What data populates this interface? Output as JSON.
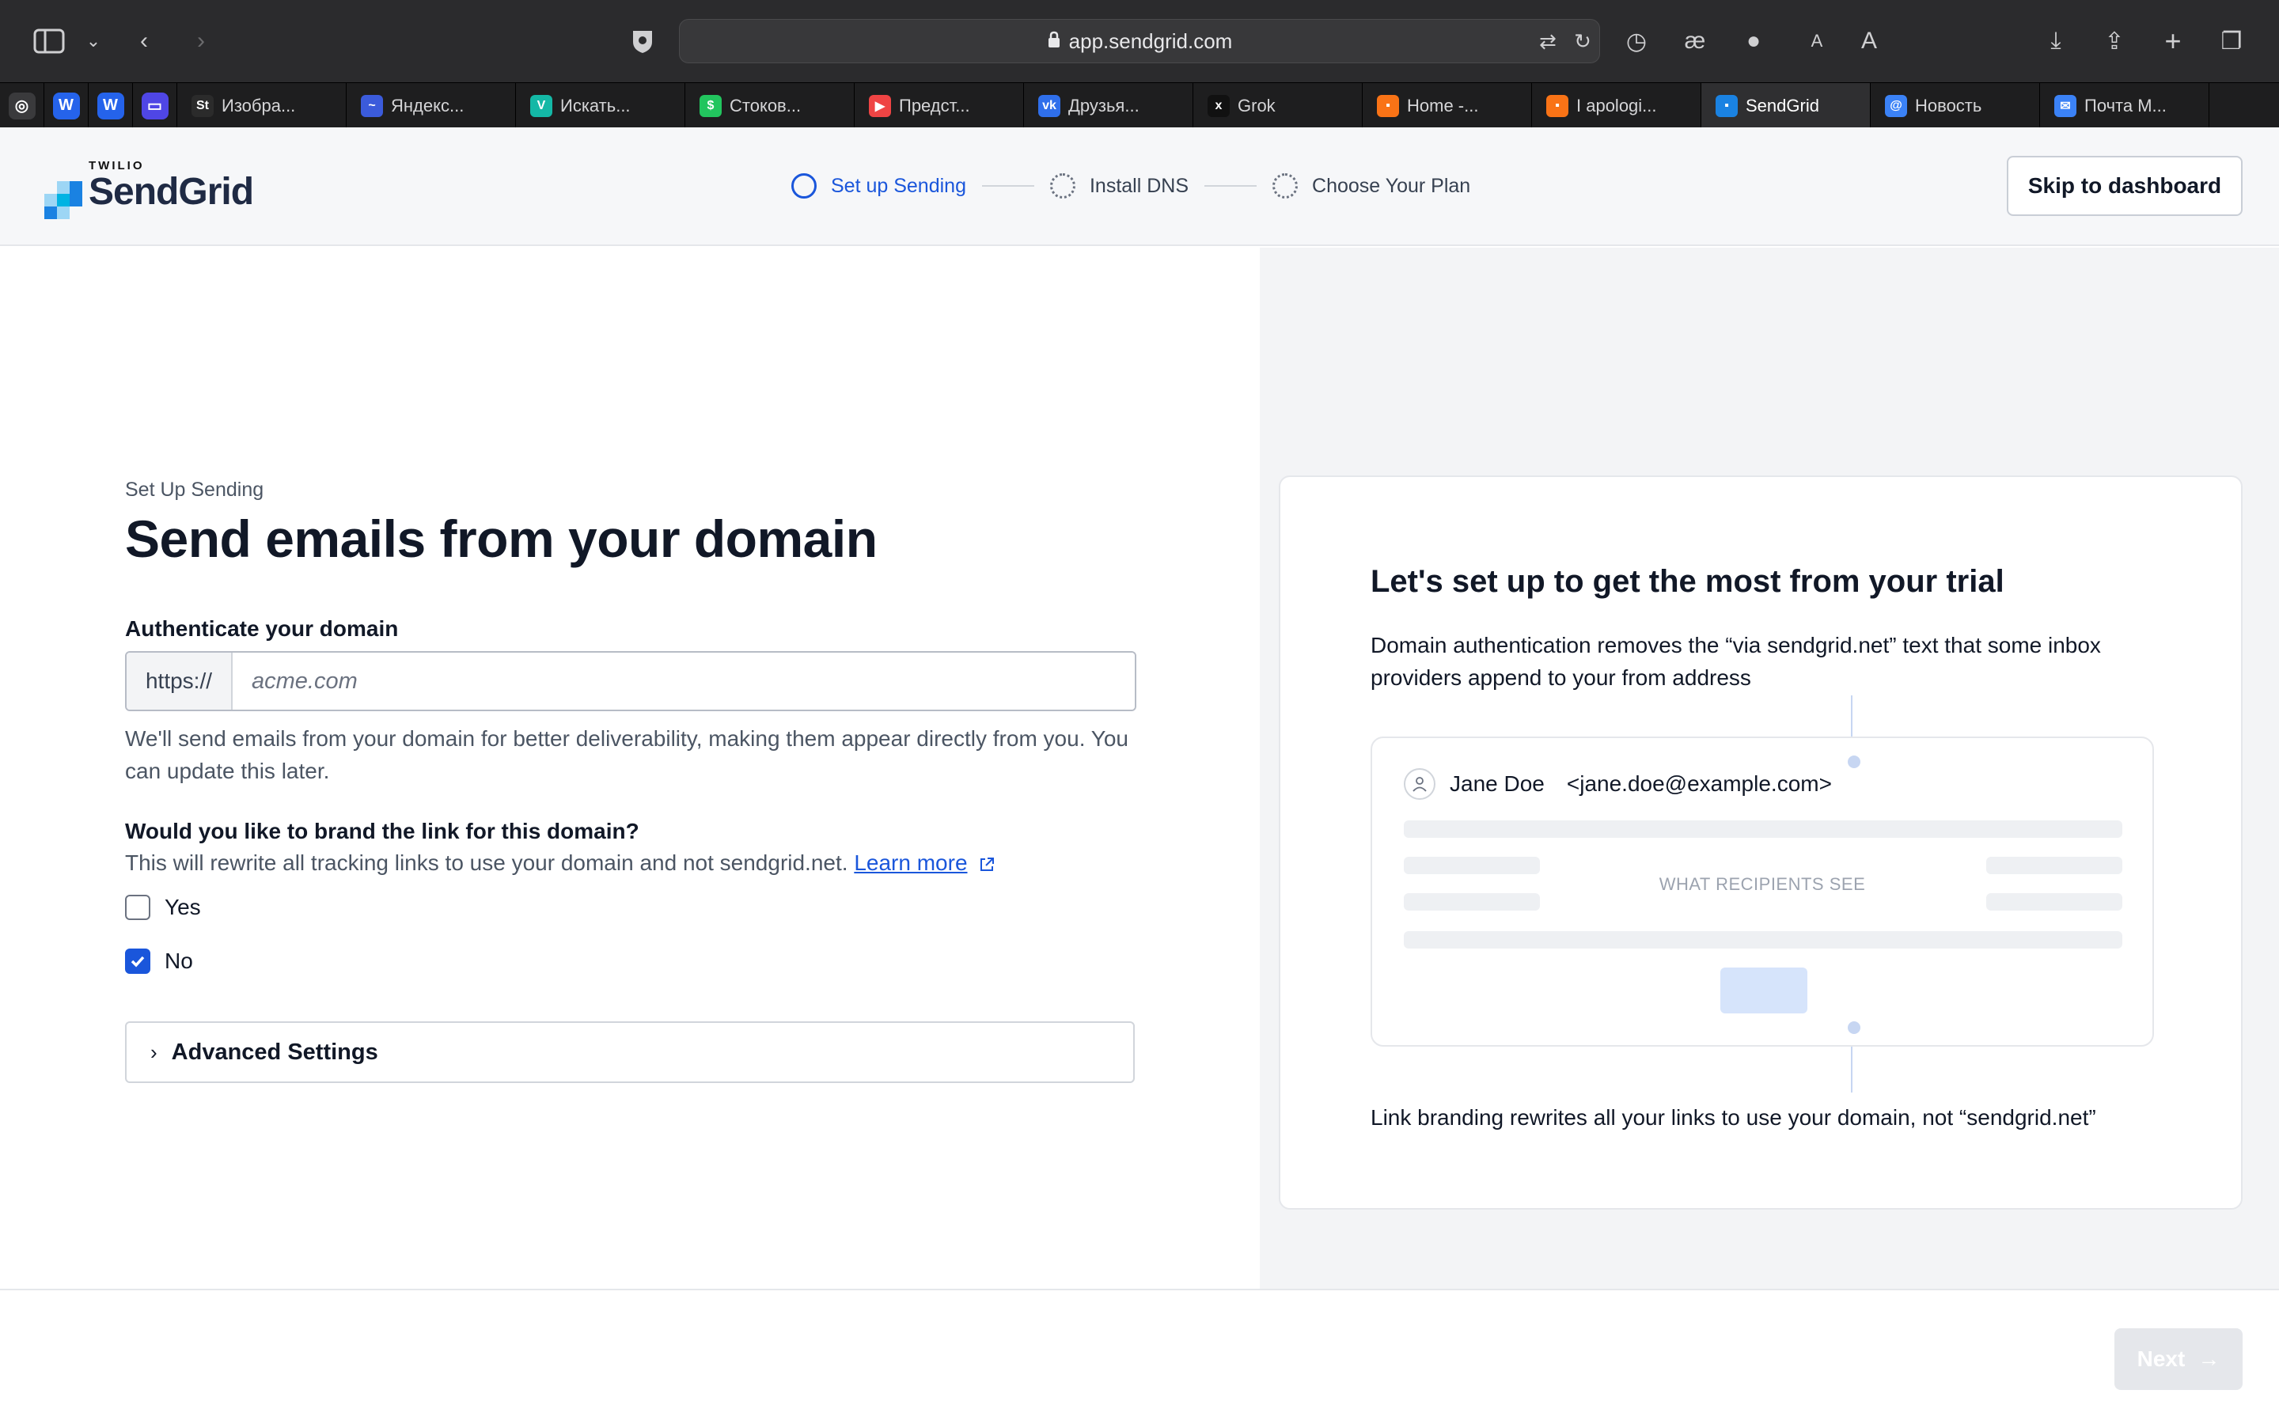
{
  "browser": {
    "url": "app.sendgrid.com",
    "tabs": [
      {
        "label": "Изобра...",
        "favicon": "St",
        "color": "#2b2b2b"
      },
      {
        "label": "Яндекс...",
        "favicon": "~",
        "color": "#3b5bdb"
      },
      {
        "label": "Искать...",
        "favicon": "V",
        "color": "#14b8a6"
      },
      {
        "label": "Стоков...",
        "favicon": "$",
        "color": "#22c55e"
      },
      {
        "label": "Предст...",
        "favicon": "▶",
        "color": "#ef4444"
      },
      {
        "label": "Друзья...",
        "favicon": "vk",
        "color": "#2f6feb"
      },
      {
        "label": "Grok",
        "favicon": "x",
        "color": "#111111"
      },
      {
        "label": "Home -...",
        "favicon": "▪",
        "color": "#f97316"
      },
      {
        "label": "I apologi...",
        "favicon": "▪",
        "color": "#f97316"
      },
      {
        "label": "SendGrid",
        "favicon": "▪",
        "color": "#1a82e2"
      },
      {
        "label": "Новость",
        "favicon": "@",
        "color": "#3b82f6"
      },
      {
        "label": "Почта М...",
        "favicon": "✉",
        "color": "#3b82f6"
      }
    ]
  },
  "header": {
    "logo_small": "TWILIO",
    "logo_word": "SendGrid",
    "steps": [
      {
        "label": "Set up Sending",
        "state": "current"
      },
      {
        "label": "Install DNS",
        "state": "pending"
      },
      {
        "label": "Choose Your Plan",
        "state": "pending"
      }
    ],
    "skip_label": "Skip to dashboard"
  },
  "form": {
    "eyebrow": "Set Up Sending",
    "title": "Send emails from your domain",
    "domain_label": "Authenticate your domain",
    "domain_prefix": "https://",
    "domain_placeholder": "acme.com",
    "domain_help": "We'll send emails from your domain for better deliverability, making them appear directly from you. You can update this later.",
    "brand_question": "Would you like to brand the link for this domain?",
    "brand_sub": "This will rewrite all tracking links to use your domain and not sendgrid.net.",
    "learn_more": "Learn more",
    "options": [
      {
        "label": "Yes",
        "checked": false
      },
      {
        "label": "No",
        "checked": true
      }
    ],
    "advanced_label": "Advanced Settings"
  },
  "card": {
    "title": "Let's set up to get the most from your trial",
    "desc": "Domain authentication removes the “via sendgrid.net” text that some inbox providers append to your from address",
    "sender_name": "Jane Doe",
    "sender_email": "<jane.doe@example.com>",
    "recipients_label": "WHAT RECIPIENTS SEE",
    "footer": "Link branding rewrites all your links to use your domain, not “sendgrid.net”"
  },
  "footer": {
    "next_label": "Next"
  },
  "colors": {
    "accent": "#1a56db",
    "brand": "#1a82e2"
  }
}
